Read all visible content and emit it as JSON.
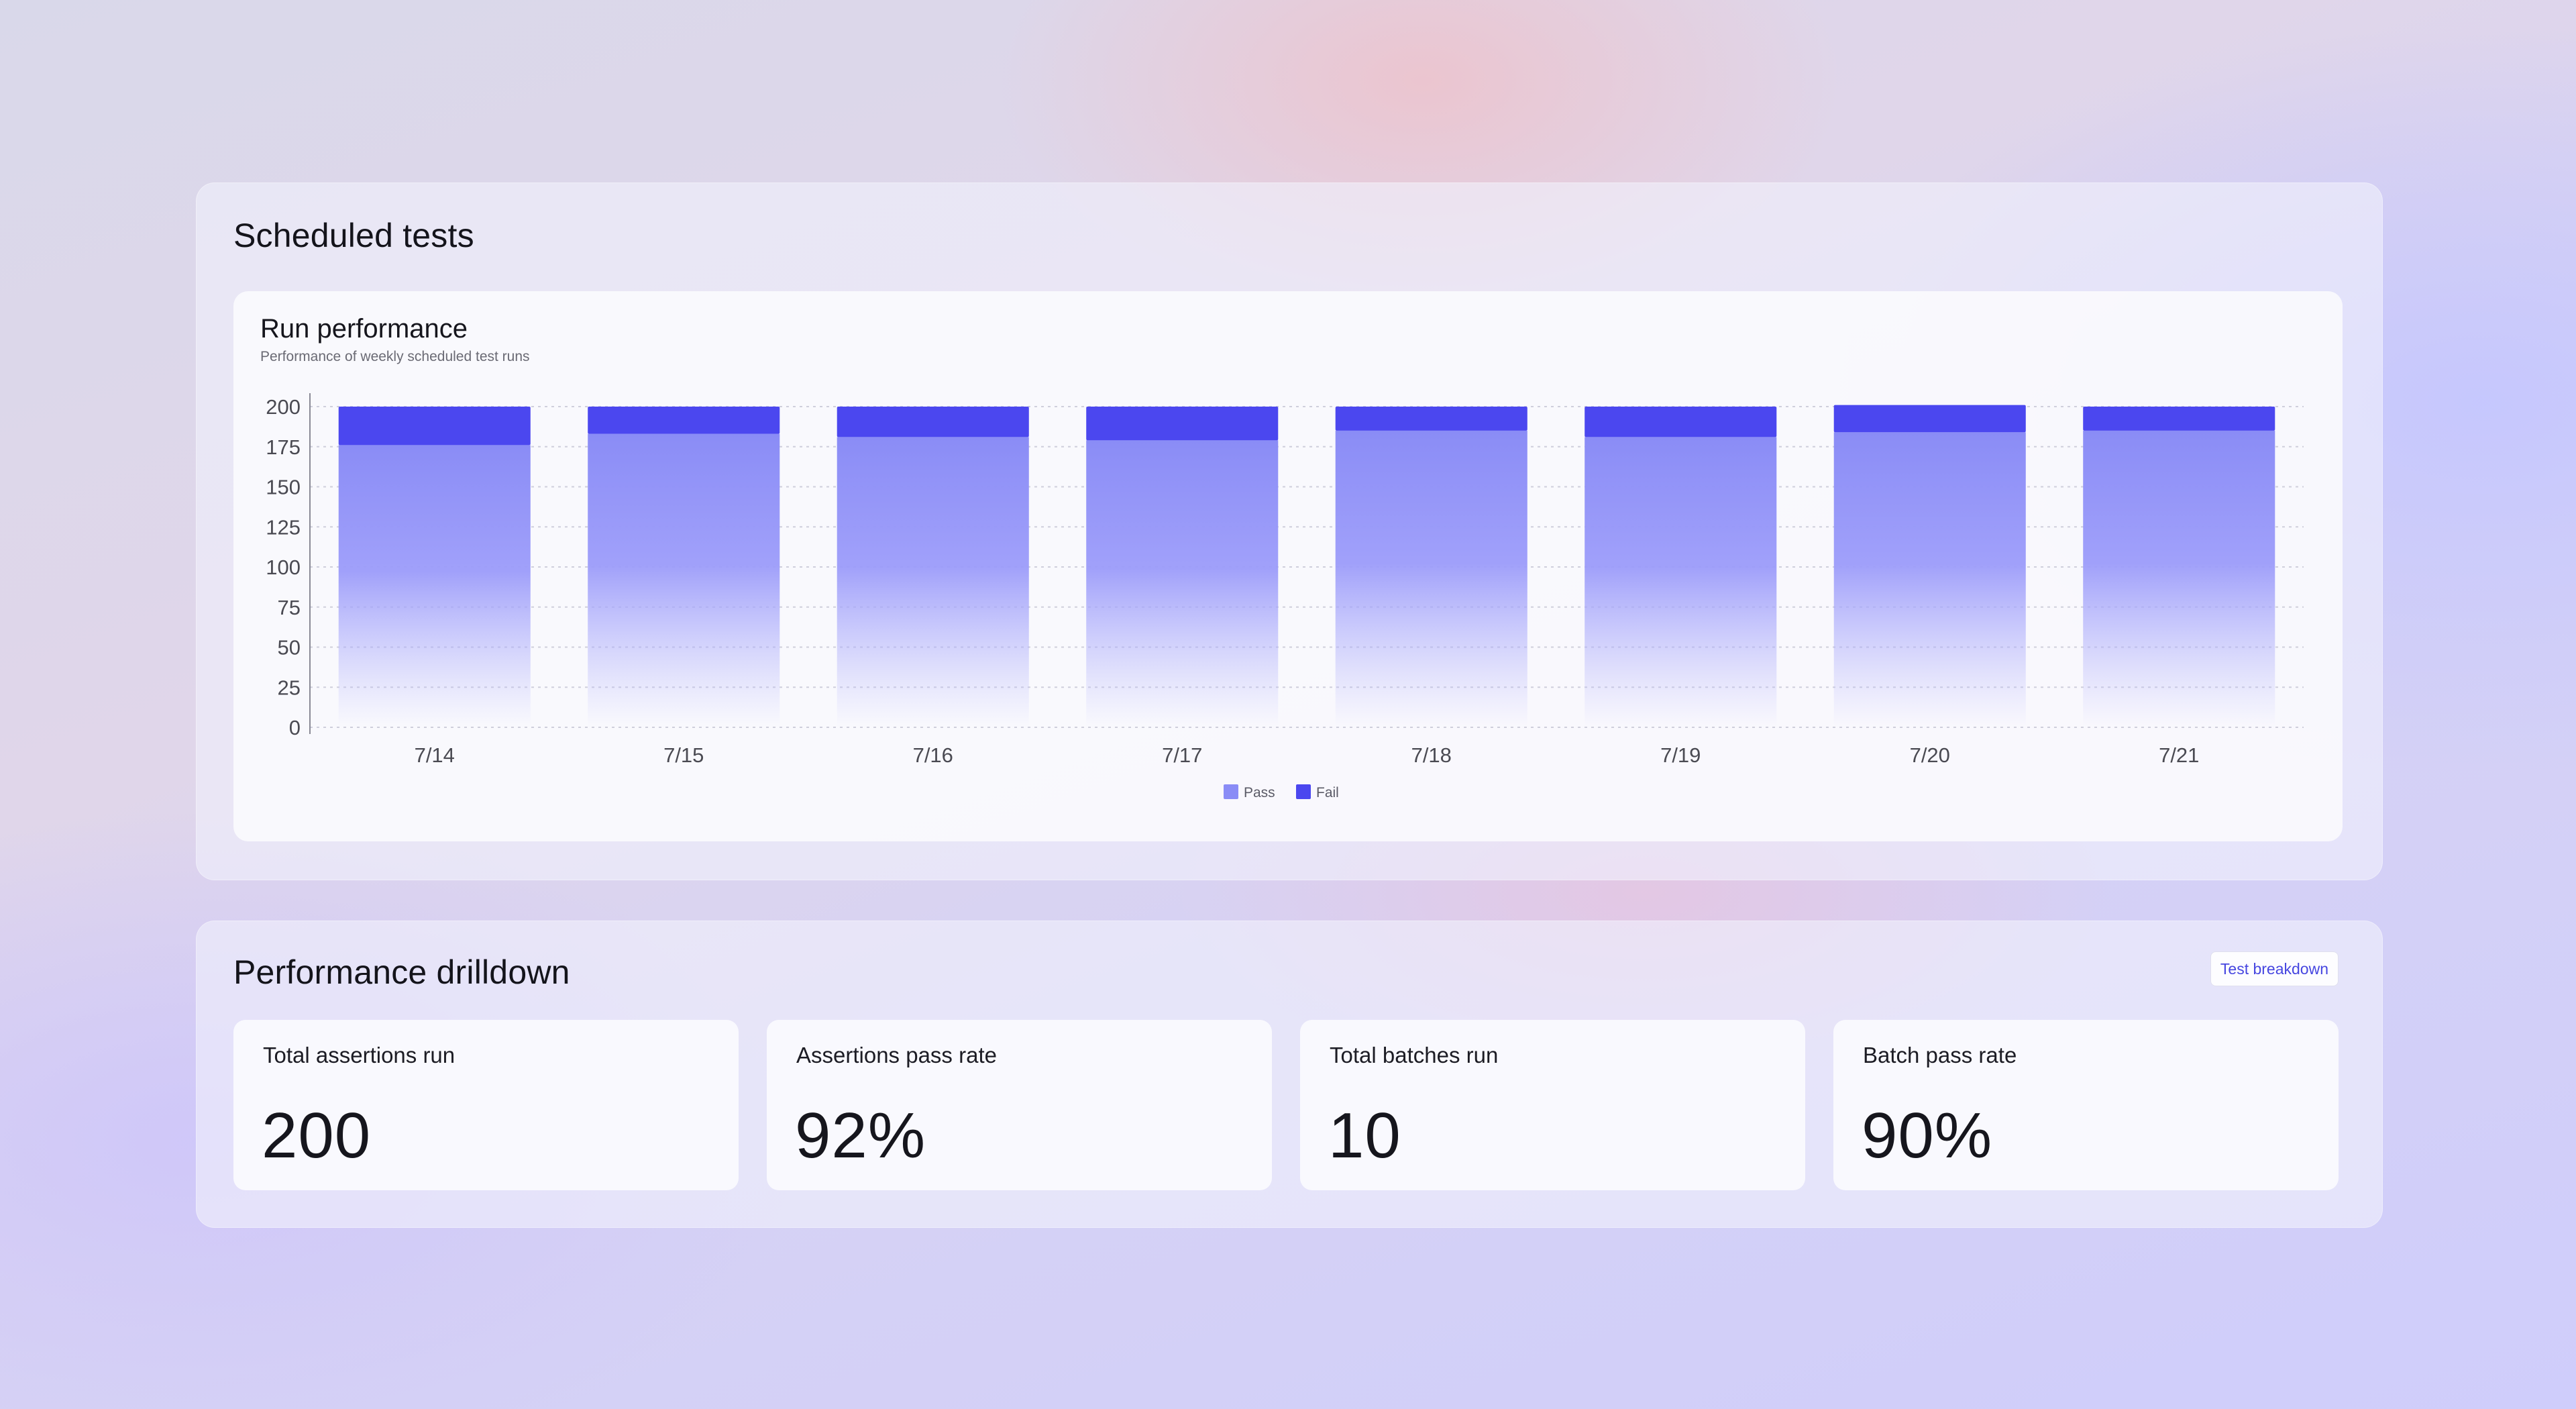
{
  "scheduled": {
    "title": "Scheduled tests"
  },
  "chart_card": {
    "title": "Run performance",
    "subtitle": "Performance of weekly scheduled test runs"
  },
  "chart_data": {
    "type": "bar",
    "stacked": true,
    "categories": [
      "7/14",
      "7/15",
      "7/16",
      "7/17",
      "7/18",
      "7/19",
      "7/20",
      "7/21"
    ],
    "series": [
      {
        "name": "Pass",
        "values": [
          176,
          183,
          181,
          179,
          185,
          181,
          184,
          185
        ],
        "color": "#8a8cf6"
      },
      {
        "name": "Fail",
        "values": [
          24,
          17,
          19,
          21,
          15,
          19,
          17,
          15
        ],
        "color": "#4b47ef"
      }
    ],
    "yticks": [
      0,
      25,
      50,
      75,
      100,
      125,
      150,
      175,
      200
    ],
    "ylim": [
      0,
      200
    ],
    "grid": true,
    "legend": "bottom-center"
  },
  "drilldown": {
    "title": "Performance drilldown",
    "button_label": "Test breakdown",
    "stats": [
      {
        "label": "Total assertions run",
        "value": "200"
      },
      {
        "label": "Assertions pass rate",
        "value": "92%"
      },
      {
        "label": "Total batches run",
        "value": "10"
      },
      {
        "label": "Batch pass rate",
        "value": "90%"
      }
    ]
  }
}
